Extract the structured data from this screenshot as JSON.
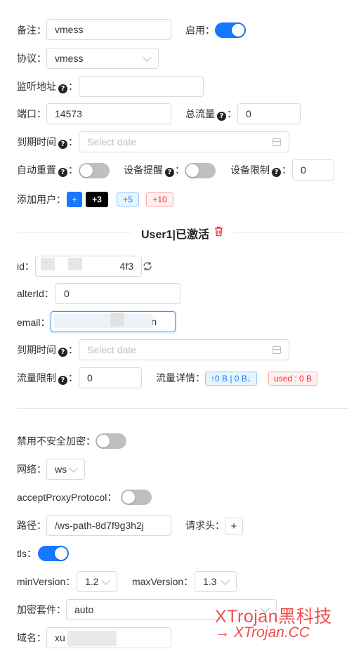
{
  "form": {
    "remark": {
      "label": "备注",
      "value": "vmess"
    },
    "enable": {
      "label": "启用",
      "on": true
    },
    "protocol": {
      "label": "协议",
      "value": "vmess"
    },
    "listen": {
      "label": "监听地址",
      "value": ""
    },
    "port": {
      "label": "端口",
      "value": "14573"
    },
    "total_traffic": {
      "label": "总流量",
      "value": "0"
    },
    "expiry": {
      "label": "到期时间",
      "placeholder": "Select date"
    },
    "auto_reset": {
      "label": "自动重置",
      "on": false
    },
    "device_alert": {
      "label": "设备提醒",
      "on": false
    },
    "device_limit": {
      "label": "设备限制",
      "value": "0"
    },
    "add_user": {
      "label": "添加用户",
      "buttons": [
        "+",
        "+3",
        "+5",
        "+10"
      ]
    }
  },
  "user": {
    "title": "User1|已激活",
    "id": {
      "label": "id",
      "value": "4f3"
    },
    "alter_id": {
      "label": "alterId",
      "value": "0"
    },
    "email": {
      "label": "email",
      "value": "n"
    },
    "expiry": {
      "label": "到期时间",
      "placeholder": "Select date"
    },
    "traffic_limit": {
      "label": "流量限制",
      "value": "0"
    },
    "traffic_detail": {
      "label": "流量详情",
      "tag_usage": "↑0 B | 0 B↓",
      "tag_used": "used : 0 B"
    }
  },
  "stream": {
    "disable_insecure": {
      "label": "禁用不安全加密",
      "on": false
    },
    "network": {
      "label": "网络",
      "value": "ws"
    },
    "accept_proxy": {
      "label": "acceptProxyProtocol",
      "on": false
    },
    "path": {
      "label": "路径",
      "value": "/ws-path-8d7f9g3h2j"
    },
    "headers": {
      "label": "请求头",
      "button": "+"
    },
    "tls": {
      "label": "tls",
      "on": true
    },
    "min_version": {
      "label": "minVersion",
      "value": "1.2"
    },
    "max_version": {
      "label": "maxVersion",
      "value": "1.3"
    },
    "cipher": {
      "label": "加密套件",
      "value": "auto"
    },
    "domain": {
      "label": "域名",
      "value": "xu"
    }
  },
  "watermark": {
    "line1": "XTrojan黑科技",
    "line2": "→ XTrojan.CC"
  },
  "colors": {
    "primary": "#1677ff",
    "danger": "#f5222d",
    "watermark": "#ef4e4e"
  }
}
